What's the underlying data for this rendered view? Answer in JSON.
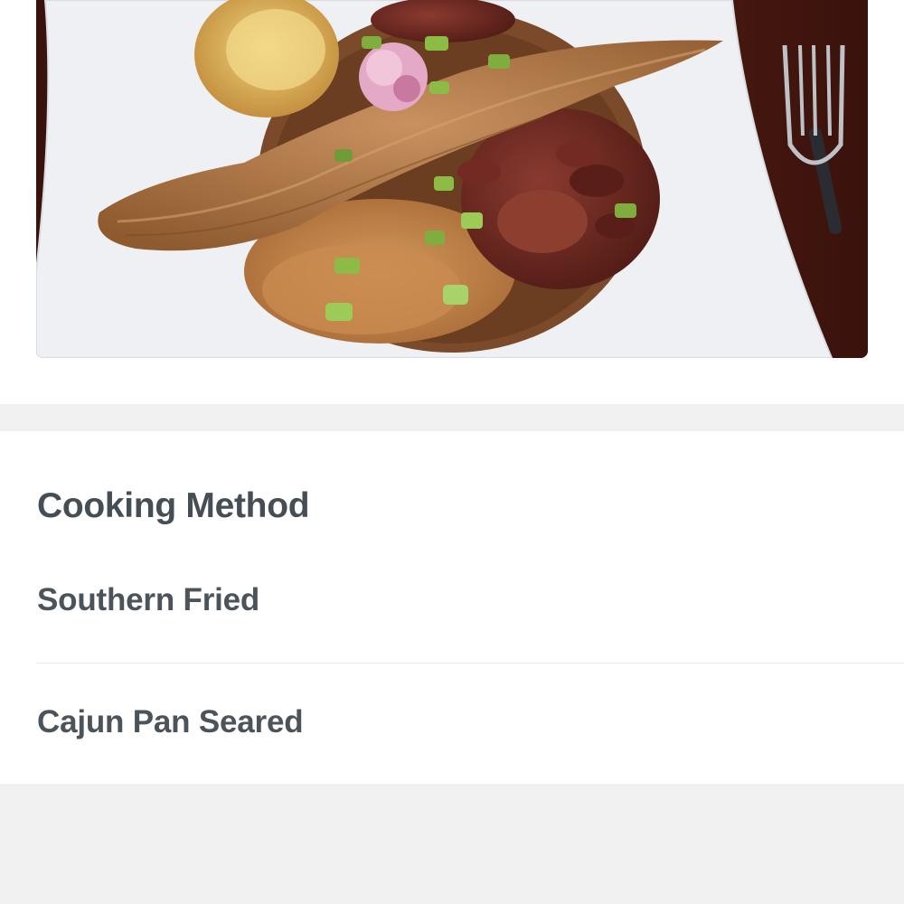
{
  "dish_photo": {
    "alt_subject": "fried-fish-plate",
    "colors": {
      "table": "#4a1a12",
      "plate": "#eef0f3",
      "fish": "#b07a45",
      "rice": "#c88a4e",
      "beans": "#6b2a22",
      "scallion": "#7fae3e"
    }
  },
  "options_section": {
    "title": "Cooking Method",
    "options": [
      {
        "label": "Southern Fried"
      },
      {
        "label": "Cajun Pan Seared"
      }
    ]
  },
  "colors": {
    "page_background": "#f1f1f1",
    "card_background": "#ffffff",
    "heading_text": "#454d55",
    "option_text": "#4c545b",
    "divider": "#ececec"
  }
}
